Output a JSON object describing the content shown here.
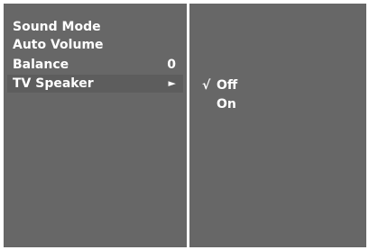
{
  "menu": {
    "items": [
      {
        "label": "Sound Mode",
        "value": ""
      },
      {
        "label": "Auto Volume",
        "value": ""
      },
      {
        "label": "Balance",
        "value": "0"
      },
      {
        "label": "TV Speaker",
        "value": "",
        "arrow": "►",
        "selected": true
      }
    ]
  },
  "submenu": {
    "check_mark": "√",
    "options": [
      {
        "label": "Off",
        "checked": true
      },
      {
        "label": "On",
        "checked": false
      }
    ]
  },
  "colors": {
    "panel_background": "#676767",
    "selected_row": "#5d5d5d",
    "text": "#ffffff",
    "frame": "#ffffff"
  }
}
